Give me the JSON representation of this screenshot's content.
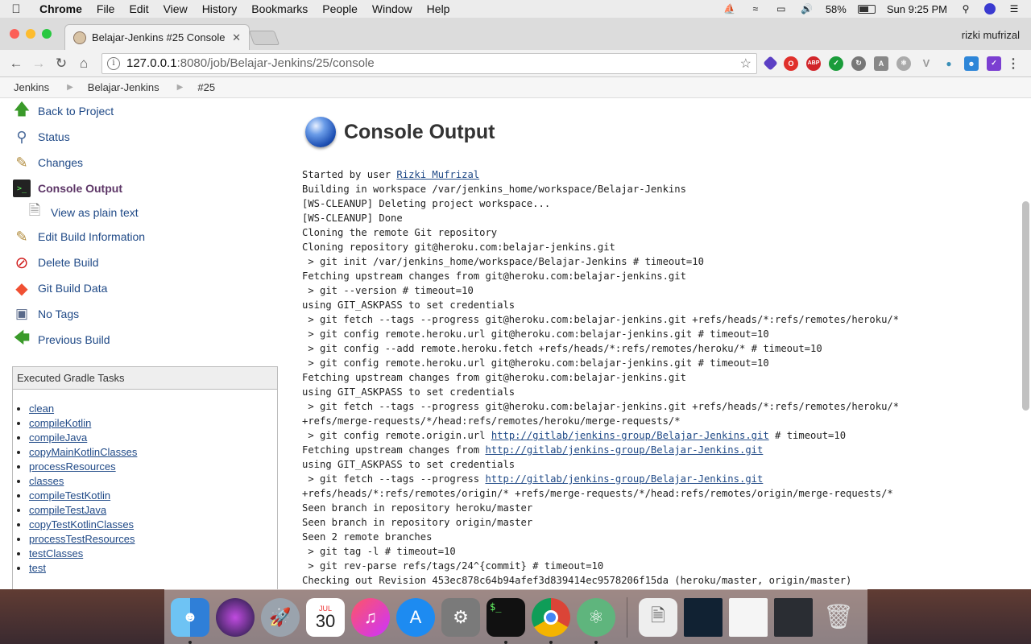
{
  "menubar": {
    "app": "Chrome",
    "items": [
      "File",
      "Edit",
      "View",
      "History",
      "Bookmarks",
      "People",
      "Window",
      "Help"
    ],
    "battery": "58%",
    "clock": "Sun 9:25 PM"
  },
  "browser": {
    "tab_title": "Belajar-Jenkins #25 Console [",
    "profile": "rizki mufrizal",
    "url_host": "127.0.0.1",
    "url_path": ":8080/job/Belajar-Jenkins/25/console"
  },
  "breadcrumbs": [
    "Jenkins",
    "Belajar-Jenkins",
    "#25"
  ],
  "sidepanel": {
    "back": "Back to Project",
    "status": "Status",
    "changes": "Changes",
    "console": "Console Output",
    "plain": "View as plain text",
    "edit": "Edit Build Information",
    "delete": "Delete Build",
    "git": "Git Build Data",
    "tags": "No Tags",
    "previous": "Previous Build"
  },
  "gradle": {
    "title": "Executed Gradle Tasks",
    "tasks": [
      "clean",
      "compileKotlin",
      "compileJava",
      "copyMainKotlinClasses",
      "processResources",
      "classes",
      "compileTestKotlin",
      "compileTestJava",
      "copyTestKotlinClasses",
      "processTestResources",
      "testClasses",
      "test"
    ]
  },
  "main": {
    "title": "Console Output"
  },
  "console": {
    "l1_prefix": "Started by user ",
    "l1_user": "Rizki Mufrizal",
    "lines_a": "Building in workspace /var/jenkins_home/workspace/Belajar-Jenkins\n[WS-CLEANUP] Deleting project workspace...\n[WS-CLEANUP] Done\nCloning the remote Git repository\nCloning repository git@heroku.com:belajar-jenkins.git\n > git init /var/jenkins_home/workspace/Belajar-Jenkins # timeout=10\nFetching upstream changes from git@heroku.com:belajar-jenkins.git\n > git --version # timeout=10\nusing GIT_ASKPASS to set credentials\n > git fetch --tags --progress git@heroku.com:belajar-jenkins.git +refs/heads/*:refs/remotes/heroku/*\n > git config remote.heroku.url git@heroku.com:belajar-jenkins.git # timeout=10\n > git config --add remote.heroku.fetch +refs/heads/*:refs/remotes/heroku/* # timeout=10\n > git config remote.heroku.url git@heroku.com:belajar-jenkins.git # timeout=10\nFetching upstream changes from git@heroku.com:belajar-jenkins.git\nusing GIT_ASKPASS to set credentials\n > git fetch --tags --progress git@heroku.com:belajar-jenkins.git +refs/heads/*:refs/remotes/heroku/*\n+refs/merge-requests/*/head:refs/remotes/heroku/merge-requests/*",
    "l_origin_prefix": " > git config remote.origin.url ",
    "gitlab_url": "http://gitlab/jenkins-group/Belajar-Jenkins.git",
    "l_origin_suffix": " # timeout=10",
    "l_fetch_prefix": "Fetching upstream changes from ",
    "l_askpass": "using GIT_ASKPASS to set credentials",
    "l_fetch2_prefix": " > git fetch --tags --progress ",
    "lines_b": "+refs/heads/*:refs/remotes/origin/* +refs/merge-requests/*/head:refs/remotes/origin/merge-requests/*\nSeen branch in repository heroku/master\nSeen branch in repository origin/master\nSeen 2 remote branches\n > git tag -l # timeout=10\n > git rev-parse refs/tags/24^{commit} # timeout=10\nChecking out Revision 453ec878c64b94afef3d839414ec9578206f15da (heroku/master, origin/master)"
  },
  "dock": {
    "calendar_month": "JUL",
    "calendar_day": "30"
  }
}
